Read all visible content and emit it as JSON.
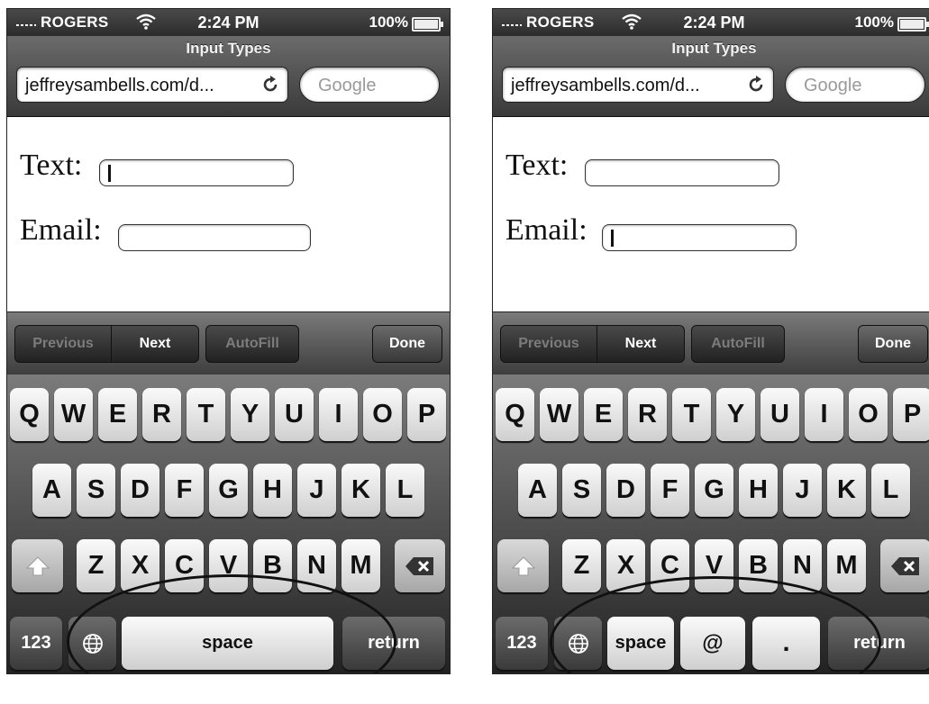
{
  "phones": [
    {
      "status": {
        "carrier": "ROGERS",
        "time": "2:24 PM",
        "battery": "100%"
      },
      "nav": {
        "title": "Input Types",
        "url": "jeffreysambells.com/d...",
        "search_placeholder": "Google"
      },
      "form": {
        "text_label": "Text:",
        "email_label": "Email:",
        "focused": "text"
      },
      "toolbar": {
        "previous": "Previous",
        "next": "Next",
        "autofill": "AutoFill",
        "done": "Done"
      },
      "keyboard": {
        "row1": [
          "Q",
          "W",
          "E",
          "R",
          "T",
          "Y",
          "U",
          "I",
          "O",
          "P"
        ],
        "row2": [
          "A",
          "S",
          "D",
          "F",
          "G",
          "H",
          "J",
          "K",
          "L"
        ],
        "row3": [
          "Z",
          "X",
          "C",
          "V",
          "B",
          "N",
          "M"
        ],
        "bottom": {
          "numbers": "123",
          "space": "space",
          "return": "return"
        }
      }
    },
    {
      "status": {
        "carrier": "ROGERS",
        "time": "2:24 PM",
        "battery": "100%"
      },
      "nav": {
        "title": "Input Types",
        "url": "jeffreysambells.com/d...",
        "search_placeholder": "Google"
      },
      "form": {
        "text_label": "Text:",
        "email_label": "Email:",
        "focused": "email"
      },
      "toolbar": {
        "previous": "Previous",
        "next": "Next",
        "autofill": "AutoFill",
        "done": "Done"
      },
      "keyboard": {
        "row1": [
          "Q",
          "W",
          "E",
          "R",
          "T",
          "Y",
          "U",
          "I",
          "O",
          "P"
        ],
        "row2": [
          "A",
          "S",
          "D",
          "F",
          "G",
          "H",
          "J",
          "K",
          "L"
        ],
        "row3": [
          "Z",
          "X",
          "C",
          "V",
          "B",
          "N",
          "M"
        ],
        "bottom": {
          "numbers": "123",
          "space": "space",
          "at": "@",
          "dot": ".",
          "return": "return"
        }
      }
    }
  ]
}
